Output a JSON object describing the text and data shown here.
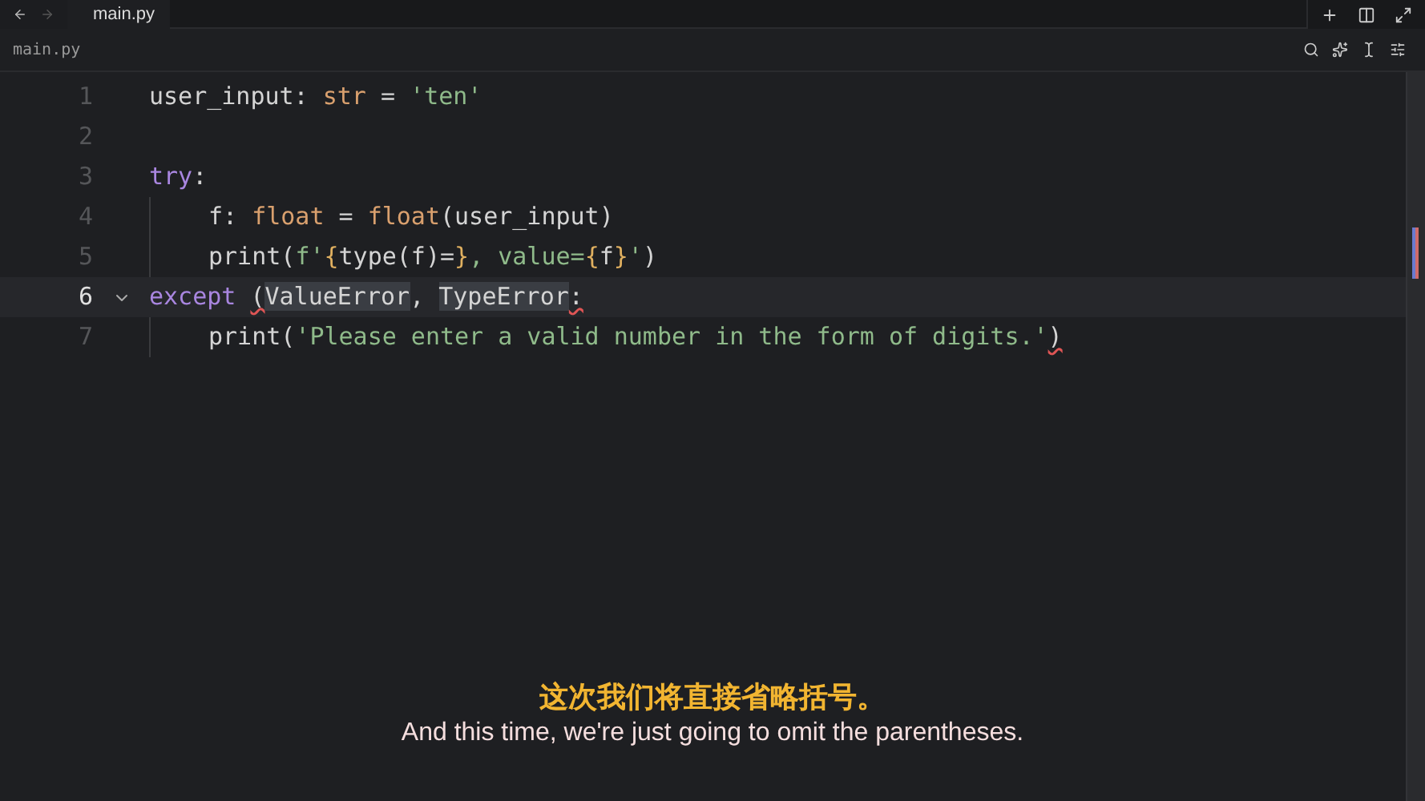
{
  "tabs": [
    {
      "label": "main.py",
      "selected": true
    }
  ],
  "breadcrumb": "main.py",
  "lines": [
    {
      "number": "1",
      "current": false,
      "tokens": [
        {
          "kind": "plain",
          "text": "user_input: "
        },
        {
          "kind": "builtin",
          "text": "str"
        },
        {
          "kind": "plain",
          "text": " = "
        },
        {
          "kind": "string",
          "text": "'ten'"
        }
      ]
    },
    {
      "number": "2",
      "current": false
    },
    {
      "number": "3",
      "current": false,
      "tokens": [
        {
          "kind": "keyword",
          "text": "try"
        },
        {
          "kind": "plain",
          "text": ":"
        }
      ],
      "children": [
        {
          "number": "4",
          "current": false,
          "tokens": [
            {
              "kind": "plain",
              "text": "f: "
            },
            {
              "kind": "builtin",
              "text": "float"
            },
            {
              "kind": "plain",
              "text": " = "
            },
            {
              "kind": "builtin",
              "text": "float"
            },
            {
              "kind": "plain",
              "text": "(user_input)"
            }
          ]
        },
        {
          "number": "5",
          "current": false,
          "tokens": [
            {
              "kind": "plain",
              "text": "print("
            },
            {
              "kind": "string",
              "text": "f'"
            },
            {
              "kind": "brace",
              "text": "{"
            },
            {
              "kind": "plain",
              "text": "type(f)="
            },
            {
              "kind": "brace",
              "text": "}"
            },
            {
              "kind": "string",
              "text": ", value="
            },
            {
              "kind": "brace",
              "text": "{"
            },
            {
              "kind": "plain",
              "text": "f"
            },
            {
              "kind": "brace",
              "text": "}"
            },
            {
              "kind": "string",
              "text": "'"
            },
            {
              "kind": "plain",
              "text": ")"
            }
          ]
        }
      ]
    },
    {
      "number": "6",
      "current": true,
      "tokens": [
        {
          "kind": "keyword",
          "text": "except "
        },
        {
          "kind": "error",
          "text": "("
        },
        {
          "kind": "highlight",
          "text": "ValueError"
        },
        {
          "kind": "plain",
          "text": ", "
        },
        {
          "kind": "highlight",
          "text": "TypeError"
        },
        {
          "kind": "error",
          "text": ":"
        }
      ],
      "children": [
        {
          "number": "7",
          "current": false,
          "tokens": [
            {
              "kind": "plain",
              "text": "print("
            },
            {
              "kind": "string",
              "text": "'Please enter a valid number in the form of digits.'"
            },
            {
              "kind": "error",
              "text": ")"
            }
          ]
        }
      ]
    }
  ],
  "subtitles": {
    "chinese": "这次我们将直接省略括号。",
    "english": "And this time, we're just going to omit the parentheses."
  }
}
